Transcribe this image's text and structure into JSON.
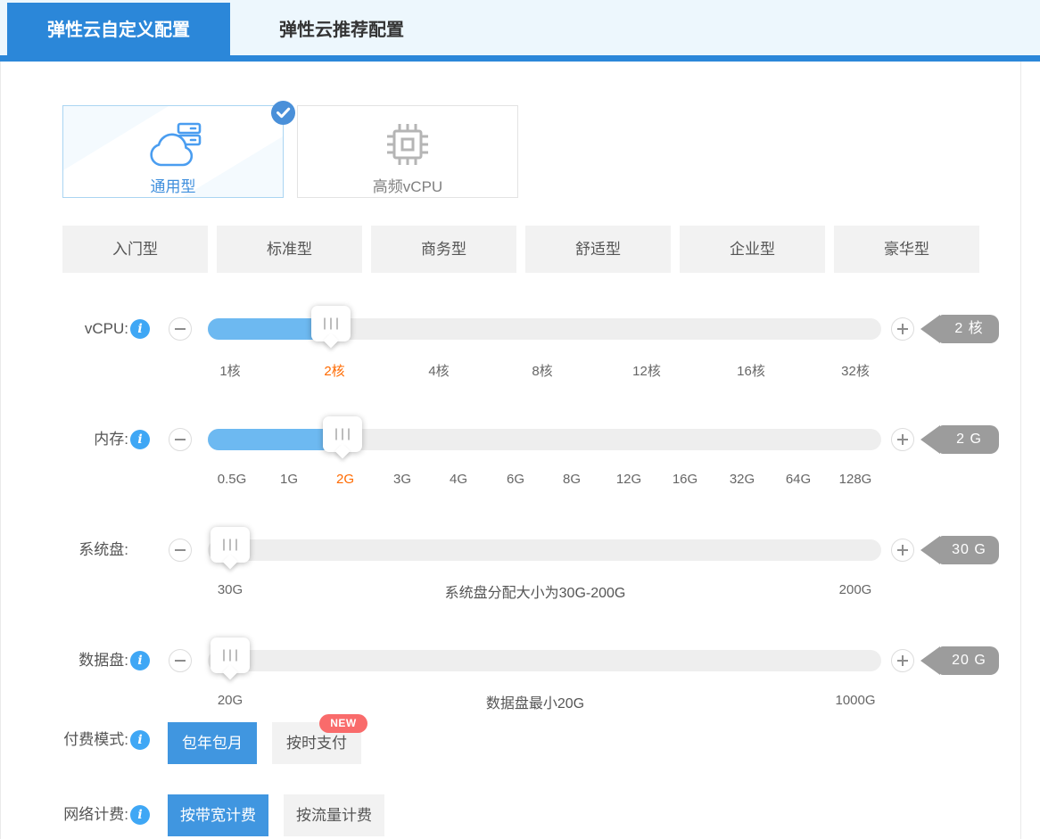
{
  "tabs": {
    "custom": "弹性云自定义配置",
    "recommended": "弹性云推荐配置"
  },
  "instance_types": {
    "general": {
      "label": "通用型",
      "selected": true
    },
    "high_freq": {
      "label": "高频vCPU",
      "selected": false
    }
  },
  "presets": [
    "入门型",
    "标准型",
    "商务型",
    "舒适型",
    "企业型",
    "豪华型"
  ],
  "sliders": {
    "vcpu": {
      "label": "vCPU:",
      "value_badge": "2 核",
      "selected": "2核",
      "ticks": [
        "1核",
        "2核",
        "4核",
        "8核",
        "12核",
        "16核",
        "32核"
      ]
    },
    "memory": {
      "label": "内存:",
      "value_badge": "2 G",
      "selected": "2G",
      "ticks": [
        "0.5G",
        "1G",
        "2G",
        "3G",
        "4G",
        "6G",
        "8G",
        "12G",
        "16G",
        "32G",
        "64G",
        "128G"
      ]
    },
    "system_disk": {
      "label": "系统盘:",
      "value_badge": "30 G",
      "min": "30G",
      "max": "200G",
      "hint": "系统盘分配大小为30G-200G"
    },
    "data_disk": {
      "label": "数据盘:",
      "value_badge": "20 G",
      "min": "20G",
      "max": "1000G",
      "hint": "数据盘最小20G"
    }
  },
  "payment": {
    "label": "付费模式:",
    "options": [
      "包年包月",
      "按时支付"
    ],
    "selected": "包年包月",
    "new_badge": "NEW"
  },
  "network": {
    "label": "网络计费:",
    "options": [
      "按带宽计费",
      "按流量计费"
    ],
    "selected": "按带宽计费"
  },
  "colors": {
    "accent_blue": "#2b87d9",
    "button_blue": "#4096e0",
    "slider_fill": "#6db9f1",
    "selected_tick": "#ff6a00",
    "value_badge": "#a1a1a1",
    "new_badge": "#f96b6b",
    "info_icon": "#3fa7f5"
  }
}
